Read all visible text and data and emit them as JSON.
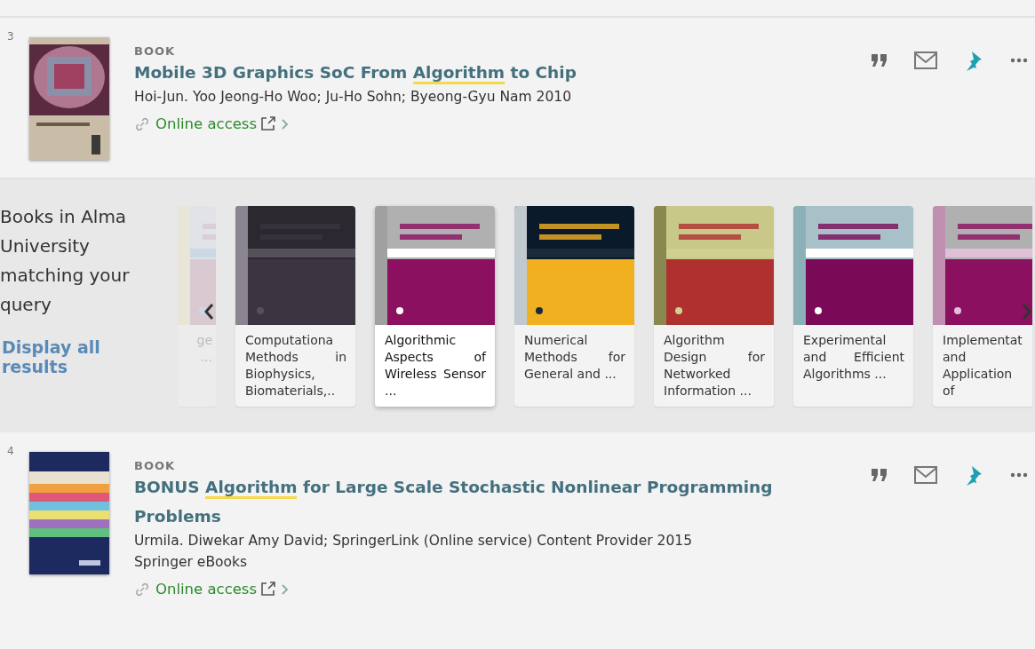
{
  "results": [
    {
      "number": "3",
      "type": "BOOK",
      "title_parts": [
        {
          "text": "Mobile 3D Graphics SoC From ",
          "highlight": false
        },
        {
          "text": "Algorithm",
          "highlight": true
        },
        {
          "text": " to Chip",
          "highlight": false
        }
      ],
      "details": [
        "Hoi-Jun. Yoo Jeong-Ho Woo; Ju-Ho Sohn; Byeong-Gyu Nam 2010"
      ],
      "link": "Online access",
      "pinned": true,
      "cover": {
        "kind": "picture"
      }
    },
    {
      "number": "4",
      "type": "BOOK",
      "title_parts": [
        {
          "text": "BONUS ",
          "highlight": false
        },
        {
          "text": "Algorithm",
          "highlight": true
        },
        {
          "text": " for Large Scale Stochastic Nonlinear Programming Problems",
          "highlight": false
        }
      ],
      "details": [
        "Urmila. Diwekar Amy David; SpringerLink (Online service) Content Provider 2015",
        "Springer eBooks"
      ],
      "link": "Online access",
      "pinned": true,
      "cover": {
        "kind": "picture"
      }
    }
  ],
  "carousel": {
    "heading": "Books in Alma University matching your query",
    "link": "Display all results",
    "cards": [
      {
        "kind": "partial",
        "title": "ge ...",
        "selected": false
      },
      {
        "kind": "full",
        "title": "Computationa Methods in Biophysics, Biomaterials,..",
        "selected": false
      },
      {
        "kind": "full",
        "title": "Algorithmic Aspects of Wireless Sensor ...",
        "selected": true
      },
      {
        "kind": "full",
        "title": "Numerical Methods for General and ...",
        "selected": false
      },
      {
        "kind": "full",
        "title": "Algorithm Design for Networked Information ...",
        "selected": false
      },
      {
        "kind": "full",
        "title": "Experimental and Efficient Algorithms ...",
        "selected": false
      },
      {
        "kind": "cut",
        "title": "Implementat and Application of",
        "selected": false
      }
    ]
  }
}
